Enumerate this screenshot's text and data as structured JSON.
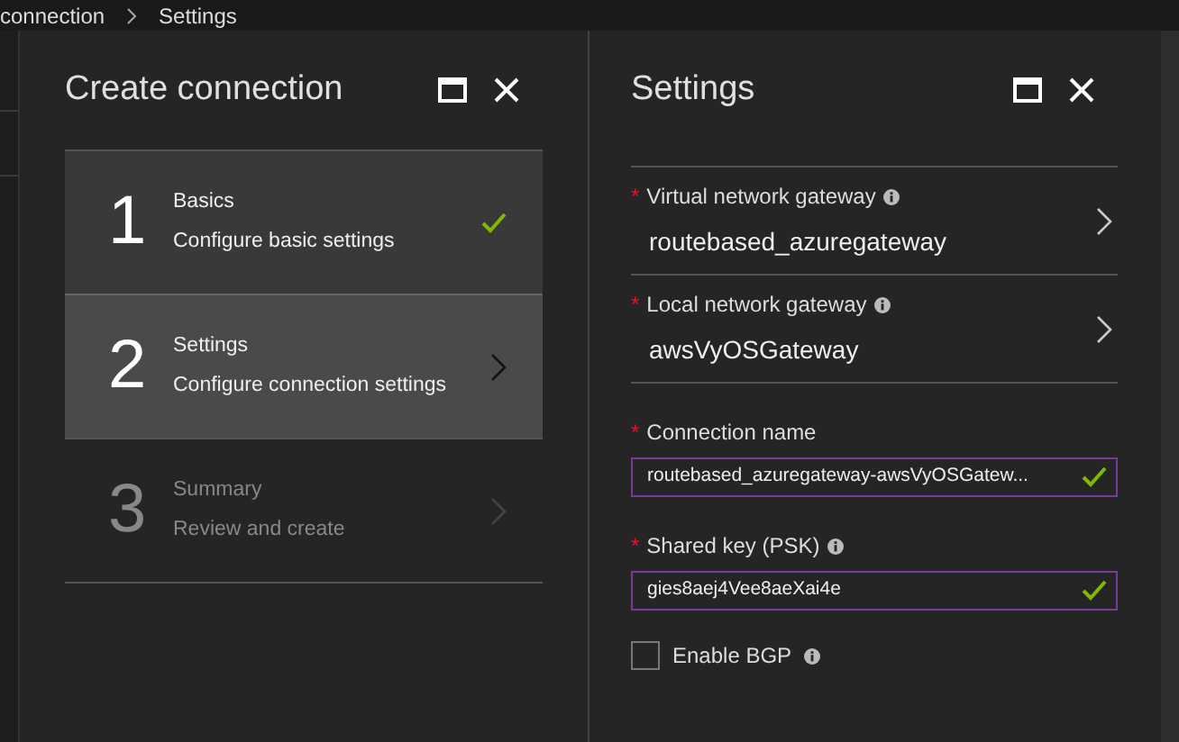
{
  "breadcrumb": [
    "connection",
    "Settings"
  ],
  "left_panel": {
    "title": "Create connection",
    "steps": [
      {
        "number": "1",
        "title": "Basics",
        "subtitle": "Configure basic settings",
        "selected": false,
        "completed": true,
        "disabled": false
      },
      {
        "number": "2",
        "title": "Settings",
        "subtitle": "Configure connection settings",
        "selected": true,
        "completed": false,
        "disabled": false
      },
      {
        "number": "3",
        "title": "Summary",
        "subtitle": "Review and create",
        "selected": false,
        "completed": false,
        "disabled": true
      }
    ]
  },
  "right_panel": {
    "title": "Settings",
    "fields": [
      {
        "kind": "picker",
        "label": "Virtual network gateway",
        "required_mark": "*",
        "info": true,
        "value": "routebased_azuregateway"
      },
      {
        "kind": "picker",
        "label": "Local network gateway",
        "required_mark": "*",
        "info": true,
        "value": "awsVyOSGateway"
      },
      {
        "kind": "textbox",
        "label": "Connection name",
        "required_mark": "*",
        "info": false,
        "value": "routebased_azuregateway-awsVyOSGatew...",
        "valid": true
      },
      {
        "kind": "textbox",
        "label": "Shared key (PSK)",
        "required_mark": "*",
        "info": true,
        "value": "gies8aej4Vee8aeXai4e",
        "valid": true
      },
      {
        "kind": "checkbox",
        "label": "Enable BGP",
        "info": true,
        "checked": false
      }
    ]
  }
}
